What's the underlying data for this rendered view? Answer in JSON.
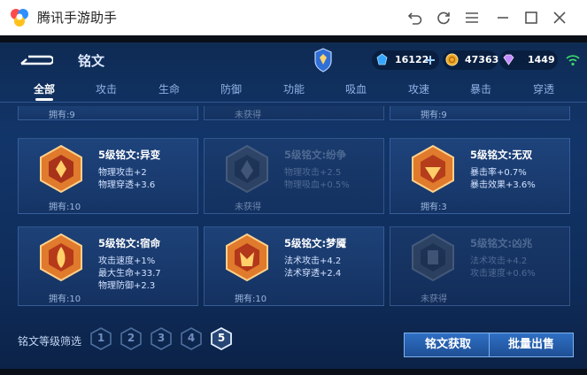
{
  "window": {
    "title": "腾讯手游助手"
  },
  "header": {
    "title": "铭文",
    "currencies": [
      {
        "icon": "diamond-icon",
        "value": "16122",
        "has_add": true
      },
      {
        "icon": "gold-coin-icon",
        "value": "47363"
      },
      {
        "icon": "gem-icon",
        "value": "1449"
      }
    ]
  },
  "tabs": [
    {
      "label": "全部",
      "active": true
    },
    {
      "label": "攻击"
    },
    {
      "label": "生命"
    },
    {
      "label": "防御"
    },
    {
      "label": "功能"
    },
    {
      "label": "吸血"
    },
    {
      "label": "攻速"
    },
    {
      "label": "暴击"
    },
    {
      "label": "穿透"
    }
  ],
  "top_row_partial": [
    {
      "owned": "拥有:9"
    },
    {
      "owned": "未获得"
    },
    {
      "owned": "拥有:9"
    }
  ],
  "cards": [
    {
      "name": "5级铭文:异变",
      "attrs": [
        "物理攻击+2",
        "物理穿透+3.6"
      ],
      "owned": "拥有:10",
      "locked": false,
      "color": "#d9682a"
    },
    {
      "name": "5级铭文:纷争",
      "attrs": [
        "物理攻击+2.5",
        "物理吸血+0.5%"
      ],
      "owned": "未获得",
      "locked": true,
      "color": "#c9452f"
    },
    {
      "name": "5级铭文:无双",
      "attrs": [
        "暴击率+0.7%",
        "暴击效果+3.6%"
      ],
      "owned": "拥有:3",
      "locked": false,
      "color": "#d9682a"
    },
    {
      "name": "5级铭文:宿命",
      "attrs": [
        "攻击速度+1%",
        "最大生命+33.7",
        "物理防御+2.3"
      ],
      "owned": "拥有:10",
      "locked": false,
      "color": "#d9682a"
    },
    {
      "name": "5级铭文:梦魇",
      "attrs": [
        "法术攻击+4.2",
        "法术穿透+2.4"
      ],
      "owned": "拥有:10",
      "locked": false,
      "color": "#d9682a"
    },
    {
      "name": "5级铭文:凶兆",
      "attrs": [
        "法术攻击+4.2",
        "攻击速度+0.6%"
      ],
      "owned": "未获得",
      "locked": true,
      "color": "#c9452f"
    }
  ],
  "footer": {
    "filter_label": "铭文等级筛选",
    "levels": [
      "1",
      "2",
      "3",
      "4",
      "5"
    ],
    "active_level": "5",
    "get_button": "铭文获取",
    "sell_button": "批量出售"
  }
}
